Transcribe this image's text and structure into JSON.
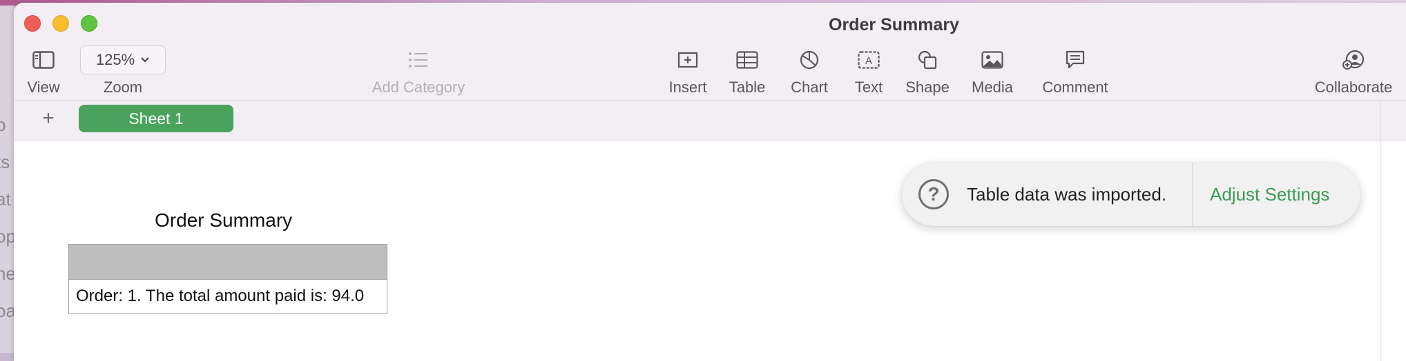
{
  "window": {
    "title": "Order Summary"
  },
  "toolbar": {
    "view_label": "View",
    "zoom_value": "125%",
    "zoom_label": "Zoom",
    "add_category_label": "Add Category",
    "insert_label": "Insert",
    "table_label": "Table",
    "chart_label": "Chart",
    "text_label": "Text",
    "shape_label": "Shape",
    "media_label": "Media",
    "comment_label": "Comment",
    "collaborate_label": "Collaborate"
  },
  "tabs": {
    "add_label": "+",
    "sheets": [
      {
        "label": "Sheet 1",
        "active": true
      }
    ]
  },
  "sheet": {
    "table_title": "Order Summary",
    "rows": [
      "Order: 1. The total amount paid is: 94.0"
    ]
  },
  "toast": {
    "icon": "question-icon",
    "message": "Table data was imported.",
    "action_label": "Adjust Settings"
  },
  "colors": {
    "accent": "#4aa35c",
    "action_text": "#3b9a52"
  }
}
